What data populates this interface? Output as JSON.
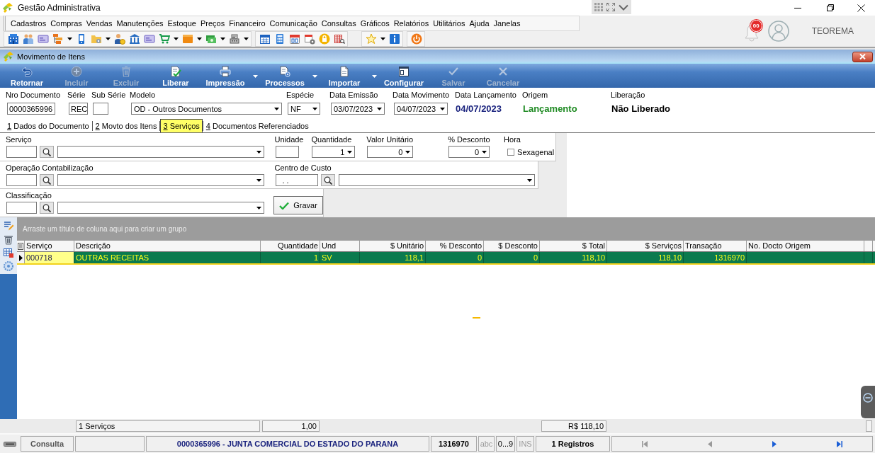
{
  "app": {
    "title": "Gestão Administrativa",
    "notifications": "00",
    "user": "TEOREMA"
  },
  "menu": [
    "Cadastros",
    "Compras",
    "Vendas",
    "Manutenções",
    "Estoque",
    "Preços",
    "Financeiro",
    "Comunicação",
    "Consultas",
    "Gráficos",
    "Relatórios",
    "Utilitários",
    "Ajuda",
    "Janelas"
  ],
  "window": {
    "title": "Movimento de Itens"
  },
  "actions": [
    {
      "label": "Retornar",
      "disabled": false,
      "dropdown": false
    },
    {
      "label": "Incluir",
      "disabled": true,
      "dropdown": false
    },
    {
      "label": "Excluir",
      "disabled": true,
      "dropdown": false
    },
    {
      "label": "Liberar",
      "disabled": false,
      "dropdown": false
    },
    {
      "label": "Impressão",
      "disabled": false,
      "dropdown": true
    },
    {
      "label": "Processos",
      "disabled": false,
      "dropdown": true
    },
    {
      "label": "Importar",
      "disabled": false,
      "dropdown": true
    },
    {
      "label": "Configurar",
      "disabled": false,
      "dropdown": false
    },
    {
      "label": "Salvar",
      "disabled": true,
      "dropdown": false
    },
    {
      "label": "Cancelar",
      "disabled": true,
      "dropdown": false
    }
  ],
  "header": {
    "fields": [
      {
        "label": "Nro Documento",
        "kind": "text",
        "value": "0000365996"
      },
      {
        "label": "Série",
        "kind": "text",
        "value": "REC"
      },
      {
        "label": "Sub Série",
        "kind": "text"
      },
      {
        "label": "Modelo",
        "kind": "select",
        "value": "OD - Outros Documentos"
      },
      {
        "label": "Espécie",
        "kind": "select",
        "value": "NF"
      },
      {
        "label": "Data Emissão",
        "kind": "select",
        "value": "03/07/2023"
      },
      {
        "label": "Data Movimento",
        "kind": "select",
        "value": "04/07/2023"
      },
      {
        "label": "Data Lançamento",
        "kind": "display",
        "value": "04/07/2023",
        "color": "#1a237e"
      },
      {
        "label": "Origem",
        "kind": "display",
        "value": "Lançamento",
        "color": "#1e8a22"
      },
      {
        "label": "Liberação",
        "kind": "display",
        "value": "Não Liberado",
        "color": "#000000"
      }
    ]
  },
  "tabs": [
    {
      "key": "1",
      "label": "Dados do Documento",
      "selected": false
    },
    {
      "key": "2",
      "label": "Movto dos Itens",
      "selected": false
    },
    {
      "key": "3",
      "label": "Serviços",
      "selected": true
    },
    {
      "key": "4",
      "label": "Documentos Referenciados",
      "selected": false
    }
  ],
  "service_form": {
    "rows": [
      {
        "fields": [
          {
            "label": "Serviço",
            "kind": "lookup"
          },
          {
            "label": "Unidade",
            "kind": "text"
          },
          {
            "label": "Quantidade",
            "kind": "select",
            "value": "1"
          },
          {
            "label": "Valor Unitário",
            "kind": "select",
            "value": "0"
          },
          {
            "label": "% Desconto",
            "kind": "select",
            "value": "0"
          },
          {
            "label": "Hora",
            "kind": "checkbox",
            "option": "Sexagenal",
            "checked": false
          }
        ]
      },
      {
        "fields": [
          {
            "label": "Operação Contabilização",
            "kind": "lookup"
          },
          {
            "label": "Centro de Custo",
            "kind": "lookup",
            "code": ". ."
          }
        ]
      },
      {
        "fields": [
          {
            "label": "Classificação",
            "kind": "lookup"
          }
        ]
      }
    ],
    "save_button": "Gravar"
  },
  "grid": {
    "group_hint": "Arraste um título de coluna aqui para criar um grupo",
    "columns": [
      "Serviço",
      "Descrição",
      "Quantidade",
      "Und",
      "$ Unitário",
      "% Desconto",
      "$ Desconto",
      "$ Total",
      "$ Serviços",
      "Transação",
      "No. Docto Origem"
    ],
    "rows": [
      {
        "selected": true,
        "cells": [
          "000718",
          "OUTRAS RECEITAS",
          "1",
          "SV",
          "118,1",
          "0",
          "0",
          "118,10",
          "118,10",
          "1316970"
        ]
      }
    ],
    "totals": {
      "count": "1 Serviços",
      "quantity": "1,00",
      "total": "R$ 118,10"
    }
  },
  "status_bar": {
    "mode": "Consulta",
    "document": "0000365996 - JUNTA COMERCIAL DO ESTADO DO PARANA",
    "transaction": "1316970",
    "indicators": [
      {
        "label": "abc",
        "on": false
      },
      {
        "label": "0...9",
        "on": true
      },
      {
        "label": "INS",
        "on": false
      }
    ],
    "records": "1 Registros",
    "navigation": [
      {
        "kind": "first",
        "disabled": true
      },
      {
        "kind": "previous",
        "disabled": true
      },
      {
        "kind": "next",
        "disabled": false
      },
      {
        "kind": "last",
        "disabled": false
      }
    ]
  }
}
